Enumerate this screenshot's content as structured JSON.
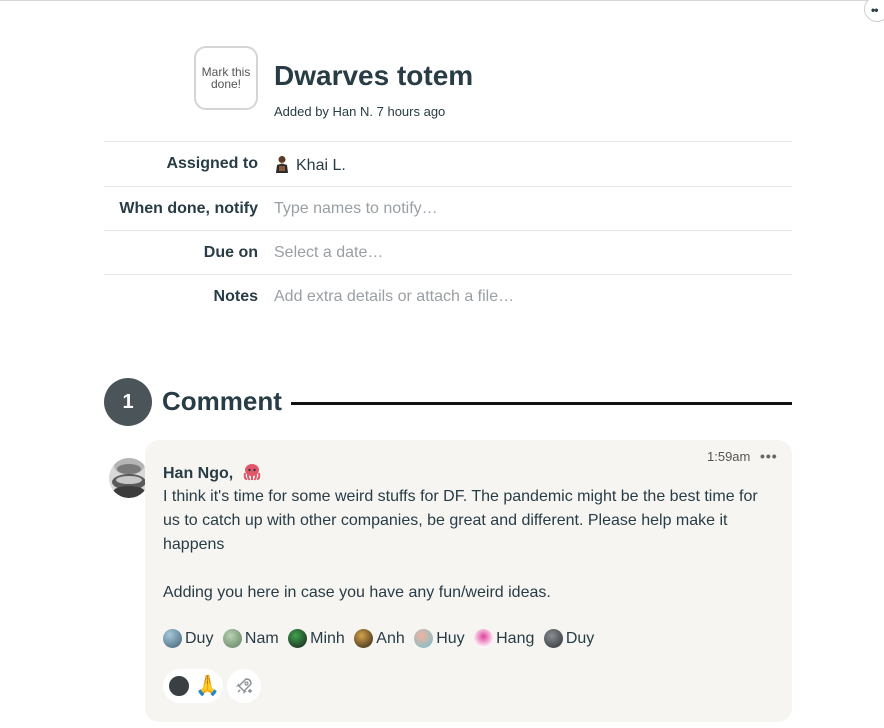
{
  "todo": {
    "mark_done_label": "Mark this done!",
    "title": "Dwarves totem",
    "added_by": "Added by Han N. 7 hours ago",
    "fields": {
      "assigned_label": "Assigned to",
      "assigned_value": "Khai L.",
      "notify_label": "When done, notify",
      "notify_placeholder": "Type names to notify…",
      "due_label": "Due on",
      "due_placeholder": "Select a date…",
      "notes_label": "Notes",
      "notes_placeholder": "Add extra details or attach a file…"
    }
  },
  "comments": {
    "count": "1",
    "heading": "Comment",
    "items": [
      {
        "time": "1:59am",
        "author": "Han Ngo,",
        "author_emoji": "octopus",
        "paragraph_1": "I think it's time for some weird stuffs for DF. The pandemic might be the best time for us to catch up with other companies, be great and different. Please help make it happens",
        "paragraph_2": "Adding you here in case you have any fun/weird ideas.",
        "mentions": [
          "Duy",
          "Nam",
          "Minh",
          "Anh",
          "Huy",
          "Hang",
          "Duy"
        ],
        "boost_emoji": "🙏",
        "more_label": "•••"
      }
    ]
  },
  "icons": {
    "top_more": "more-icon",
    "add_boost": "rocket-icon"
  },
  "colors": {
    "text": "#283c46",
    "placeholder": "#9a9fa3",
    "bubble": "#f7f5f2",
    "count_badge": "#4b5559",
    "octopus": "#e2566a"
  }
}
